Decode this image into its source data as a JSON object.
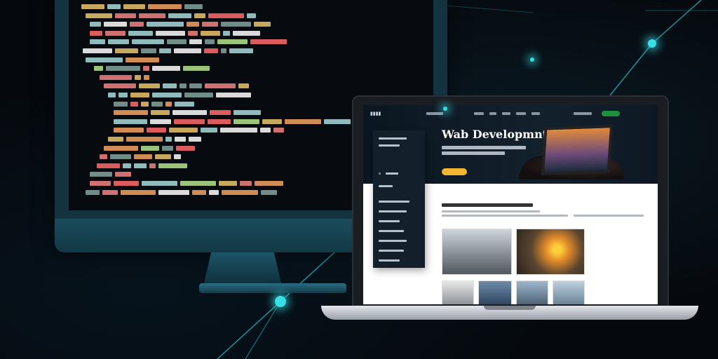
{
  "scene": {
    "description_colors": {
      "accent": "#38e0e6",
      "monitor_frame": "#12333f",
      "code_colors": [
        "#e9c46a",
        "#f28482",
        "#84a59d",
        "#a8dadc",
        "#f4a261",
        "#ffffff",
        "#b5e48c",
        "#ff6b6b"
      ]
    },
    "laptop_site": {
      "hero_title": "Wab Developmnt",
      "cta_color": "#f2b632"
    }
  }
}
